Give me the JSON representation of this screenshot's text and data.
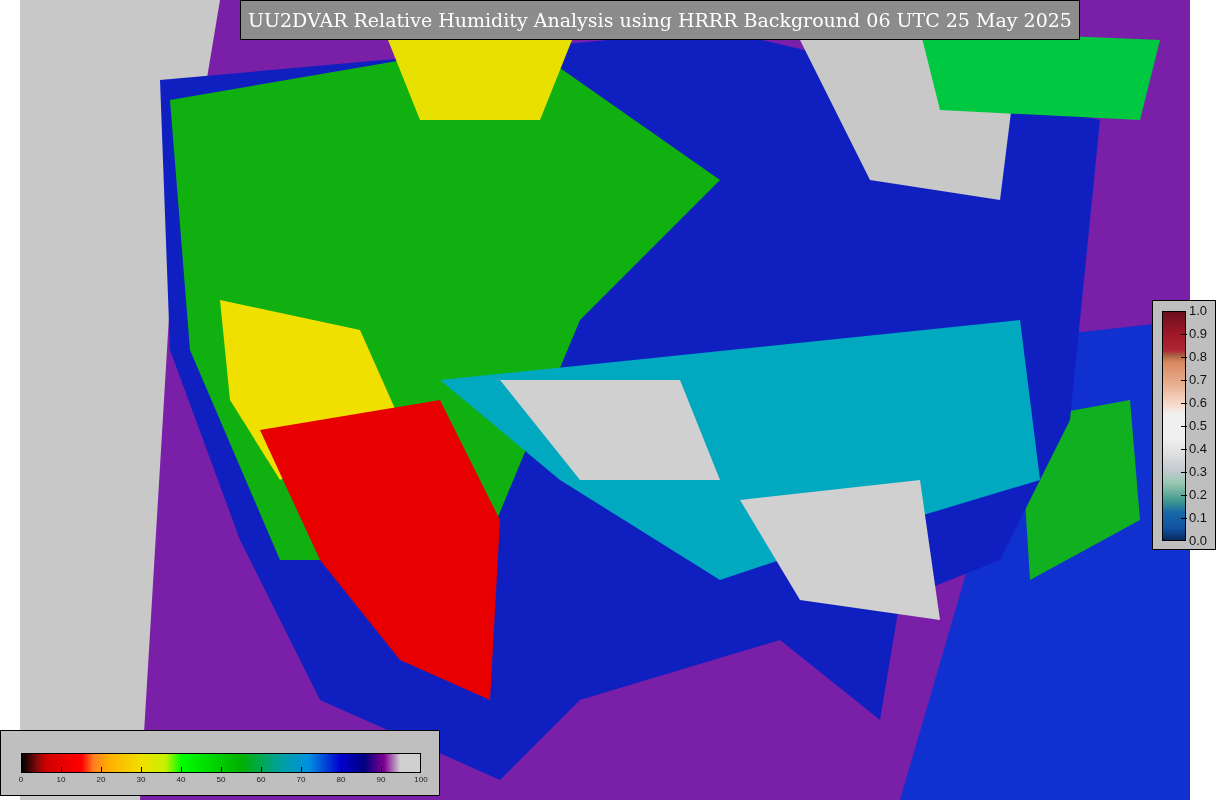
{
  "title": "UU2DVAR Relative Humidity Analysis using HRRR Background 06 UTC 25 May 2025",
  "humidity_colorbar": {
    "ticks": [
      "0",
      "10",
      "20",
      "30",
      "40",
      "50",
      "60",
      "70",
      "80",
      "90",
      "100"
    ]
  },
  "ratio_colorbar": {
    "ticks": [
      "1.0",
      "0.9",
      "0.8",
      "0.7",
      "0.6",
      "0.5",
      "0.4",
      "0.3",
      "0.2",
      "0.1",
      "0.0"
    ]
  }
}
